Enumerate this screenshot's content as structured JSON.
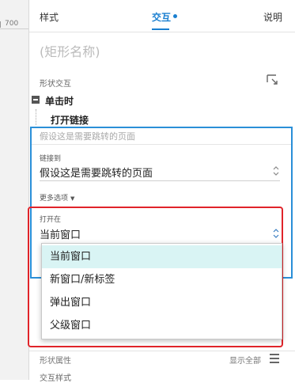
{
  "ruler": {
    "number": "700"
  },
  "tabs": {
    "style": "样式",
    "interaction": "交互",
    "notes": "说明"
  },
  "shape_name": "(矩形名称)",
  "shape_interaction": {
    "label": "形状交互"
  },
  "event": {
    "label": "单击时",
    "action": "打开链接",
    "hint": "假设这是需要跳转的页面"
  },
  "link_to": {
    "label": "链接到",
    "value": "假设这是需要跳转的页面"
  },
  "more_options": {
    "label": "更多选项"
  },
  "open_in": {
    "label": "打开在",
    "value": "当前窗口",
    "options": [
      "当前窗口",
      "新窗口/新标签",
      "弹出窗口",
      "父级窗口"
    ],
    "selected_index": 0
  },
  "shape_properties": {
    "label": "形状属性",
    "show_all": "显示全部"
  },
  "interaction_style": {
    "label": "交互样式"
  },
  "colors": {
    "accent": "#1a7fd0",
    "highlight_box": "#e0242a",
    "selected_bg": "#d9f4f4"
  }
}
